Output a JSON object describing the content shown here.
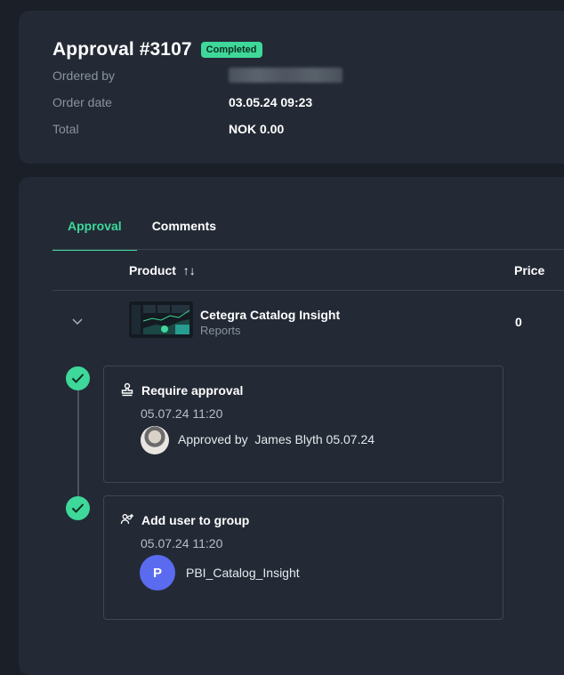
{
  "header": {
    "title": "Approval #3107",
    "status_badge": "Completed",
    "fields": [
      {
        "label": "Ordered by",
        "value": ""
      },
      {
        "label": "Order date",
        "value": "03.05.24 09:23"
      },
      {
        "label": "Total",
        "value": "NOK 0.00"
      }
    ]
  },
  "tabs": [
    {
      "label": "Approval",
      "active": true
    },
    {
      "label": "Comments",
      "active": false
    }
  ],
  "table": {
    "columns": {
      "product": "Product",
      "sort_glyph": "↑↓",
      "price": "Price"
    },
    "rows": [
      {
        "name": "Cetegra Catalog Insight",
        "category": "Reports",
        "price": "0"
      }
    ]
  },
  "steps": [
    {
      "title": "Require approval",
      "time": "05.07.24 11:20",
      "approved_by_label": "Approved by",
      "approver": "James Blyth 05.07.24",
      "icon": "stamp-icon"
    },
    {
      "title": "Add user to group",
      "time": "05.07.24 11:20",
      "group_initial": "P",
      "group_name": "PBI_Catalog_Insight",
      "icon": "add-users-icon"
    }
  ],
  "colors": {
    "accent": "#3ed89a",
    "background": "#1a1f28",
    "card": "#232a35",
    "avatar": "#5a6bf0"
  }
}
